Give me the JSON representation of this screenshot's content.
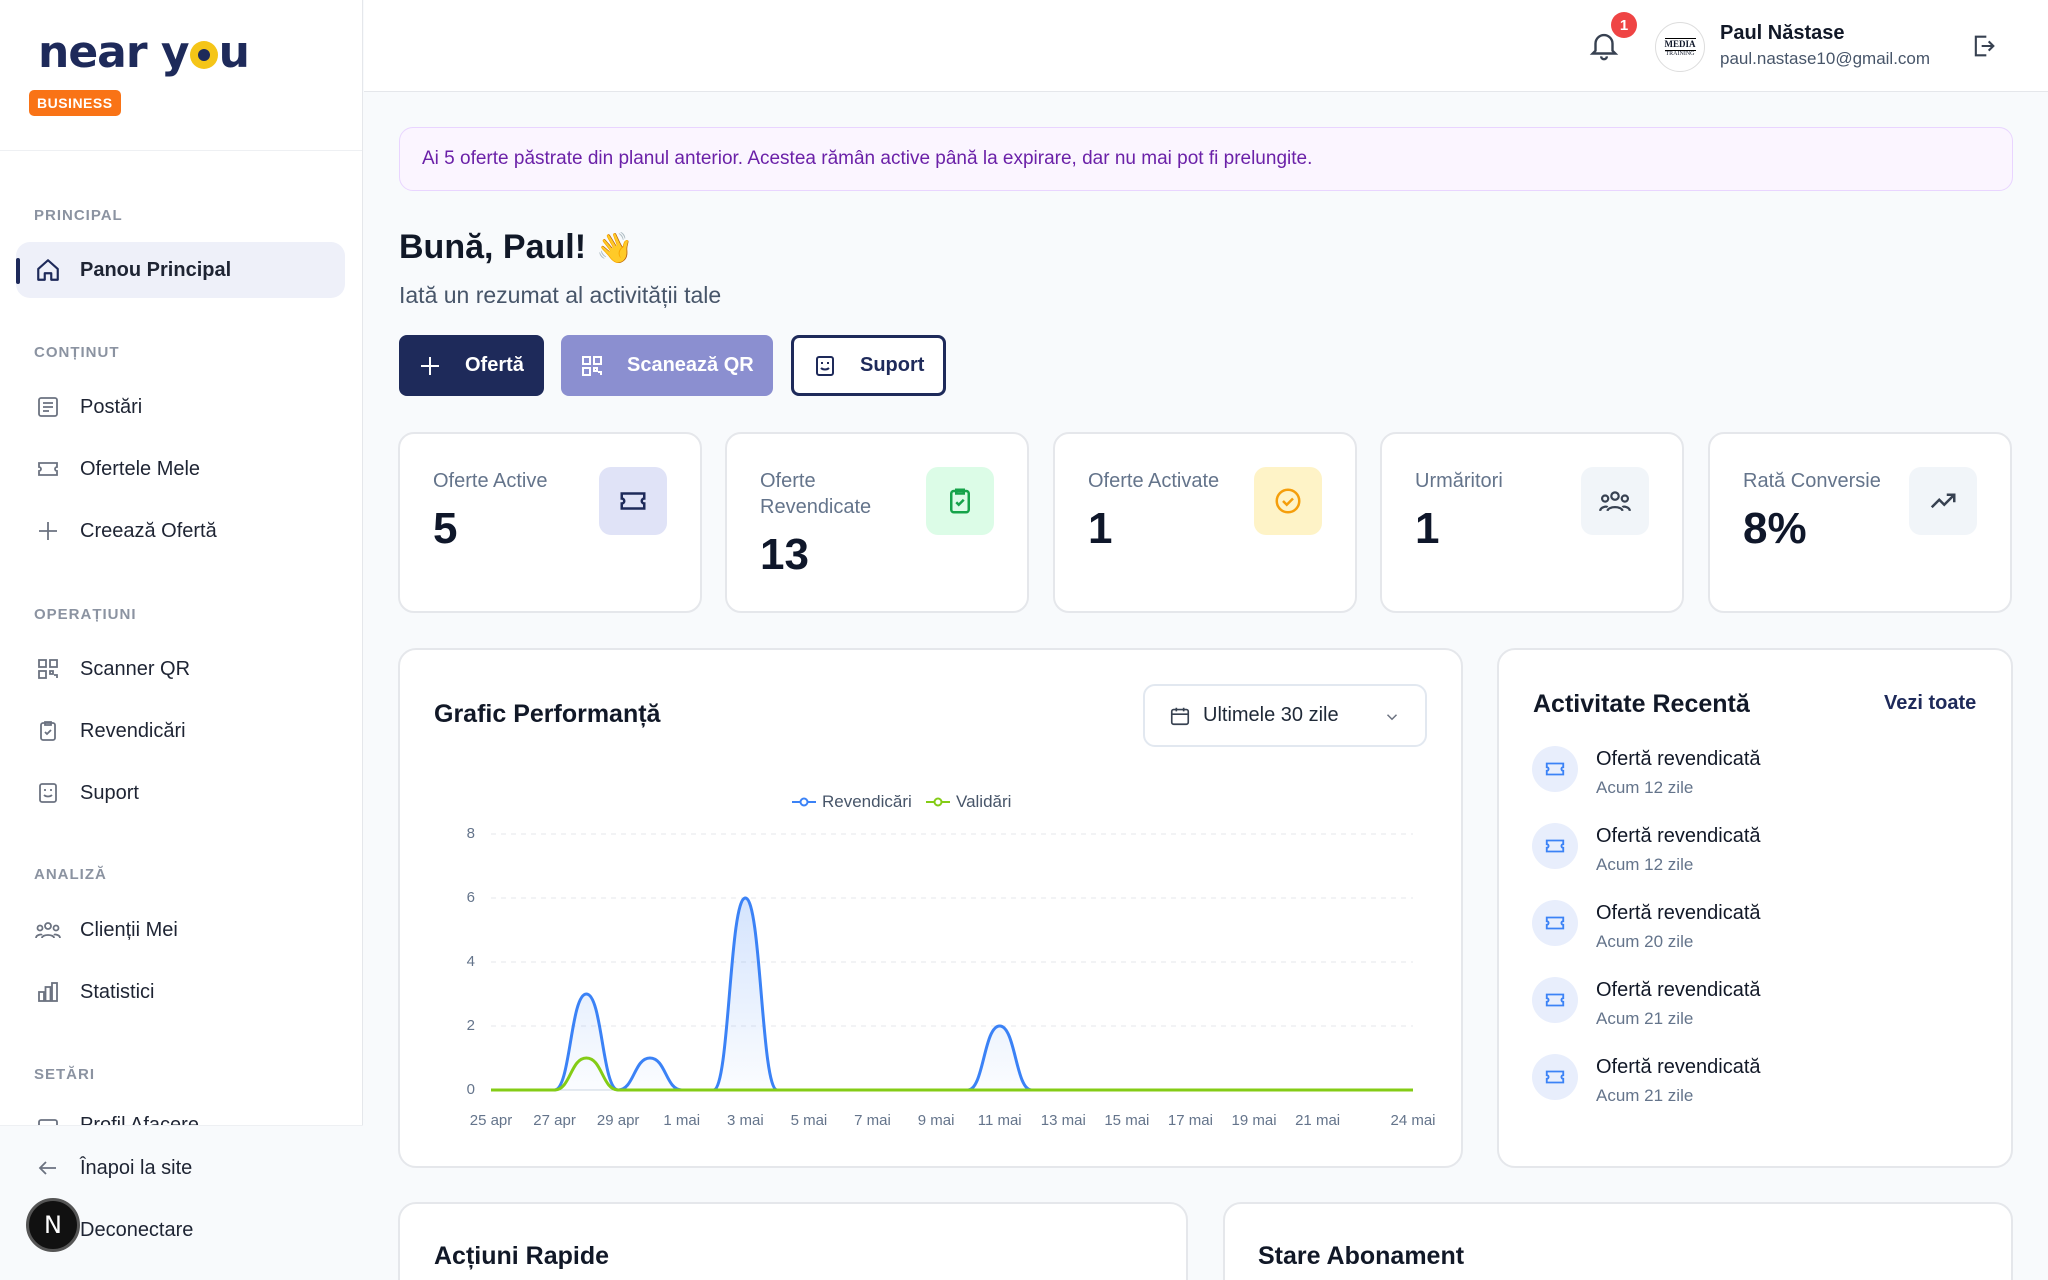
{
  "brand": {
    "logo_text_1": "near y",
    "logo_text_2": "u",
    "badge": "BUSINESS"
  },
  "sidebar": {
    "sections": {
      "principal": "PRINCIPAL",
      "continut": "CONȚINUT",
      "operatiuni": "OPERAȚIUNI",
      "analiza": "ANALIZĂ",
      "setari": "SETĂRI"
    },
    "items": {
      "panou": "Panou Principal",
      "postari": "Postări",
      "ofertele": "Ofertele Mele",
      "creeaza": "Creează Ofertă",
      "scanner": "Scanner QR",
      "revendicari": "Revendicări",
      "suport": "Suport",
      "clienti": "Clienții Mei",
      "statistici": "Statistici",
      "profil": "Profil Afacere"
    },
    "bottom": {
      "back": "Înapoi la site",
      "logout": "Deconectare"
    },
    "bubble": "N"
  },
  "header": {
    "notifications_count": "1",
    "avatar_line1": "MEDIA",
    "avatar_line2": "TRAINING",
    "user_name": "Paul Năstase",
    "user_email": "paul.nastase10@gmail.com"
  },
  "notice": "Ai 5 oferte păstrate din planul anterior. Acestea rămân active până la expirare, dar nu mai pot fi prelungite.",
  "greeting": {
    "title": "Bună, Paul!",
    "emoji": "👋",
    "subtitle": "Iată un rezumat al activității tale"
  },
  "actions": {
    "offer": "Ofertă",
    "scan": "Scanează QR",
    "support": "Suport"
  },
  "stats": [
    {
      "label": "Oferte Active",
      "value": "5",
      "icon": "ticket-icon",
      "color": "#e0e3f7"
    },
    {
      "label": "Oferte Revendicate",
      "value": "13",
      "icon": "clipboard-check-icon",
      "color": "#dcfce7"
    },
    {
      "label": "Oferte Activate",
      "value": "1",
      "icon": "check-circle-icon",
      "color": "#fef3c7"
    },
    {
      "label": "Urmăritori",
      "value": "1",
      "icon": "users-icon",
      "color": "#f1f5f9"
    },
    {
      "label": "Rată Conversie",
      "value": "8%",
      "icon": "trending-up-icon",
      "color": "#f1f5f9"
    }
  ],
  "performance": {
    "title": "Grafic Performanță",
    "range": "Ultimele 30 zile"
  },
  "chart_data": {
    "type": "line",
    "title": "",
    "x": [
      "25 apr",
      "26 apr",
      "27 apr",
      "28 apr",
      "29 apr",
      "30 apr",
      "1 mai",
      "2 mai",
      "3 mai",
      "4 mai",
      "5 mai",
      "6 mai",
      "7 mai",
      "8 mai",
      "9 mai",
      "10 mai",
      "11 mai",
      "12 mai",
      "13 mai",
      "14 mai",
      "15 mai",
      "16 mai",
      "17 mai",
      "18 mai",
      "19 mai",
      "20 mai",
      "21 mai",
      "22 mai",
      "23 mai",
      "24 mai"
    ],
    "x_tick_labels": [
      "25 apr",
      "27 apr",
      "29 apr",
      "1 mai",
      "3 mai",
      "5 mai",
      "7 mai",
      "9 mai",
      "11 mai",
      "13 mai",
      "15 mai",
      "17 mai",
      "19 mai",
      "21 mai",
      "24 mai"
    ],
    "series": [
      {
        "name": "Revendicări",
        "color": "#3b82f6",
        "values": [
          0,
          0,
          0,
          3,
          0,
          1,
          0,
          0,
          6,
          0,
          0,
          0,
          0,
          0,
          0,
          0,
          2,
          0,
          0,
          0,
          0,
          0,
          0,
          0,
          0,
          0,
          0,
          0,
          0,
          0
        ]
      },
      {
        "name": "Validări",
        "color": "#84cc16",
        "values": [
          0,
          0,
          0,
          1,
          0,
          0,
          0,
          0,
          0,
          0,
          0,
          0,
          0,
          0,
          0,
          0,
          0,
          0,
          0,
          0,
          0,
          0,
          0,
          0,
          0,
          0,
          0,
          0,
          0,
          0
        ]
      }
    ],
    "ylim": [
      0,
      8
    ],
    "y_ticks": [
      "0",
      "2",
      "4",
      "6",
      "8"
    ],
    "grid": true,
    "legend": "top-center"
  },
  "activity": {
    "title": "Activitate Recentă",
    "see_all": "Vezi toate",
    "items": [
      {
        "title": "Ofertă revendicată",
        "time": "Acum 12 zile"
      },
      {
        "title": "Ofertă revendicată",
        "time": "Acum 12 zile"
      },
      {
        "title": "Ofertă revendicată",
        "time": "Acum 20 zile"
      },
      {
        "title": "Ofertă revendicată",
        "time": "Acum 21 zile"
      },
      {
        "title": "Ofertă revendicată",
        "time": "Acum 21 zile"
      }
    ]
  },
  "bottom_cards": {
    "quick": "Acțiuni Rapide",
    "subscription": "Stare Abonament"
  }
}
